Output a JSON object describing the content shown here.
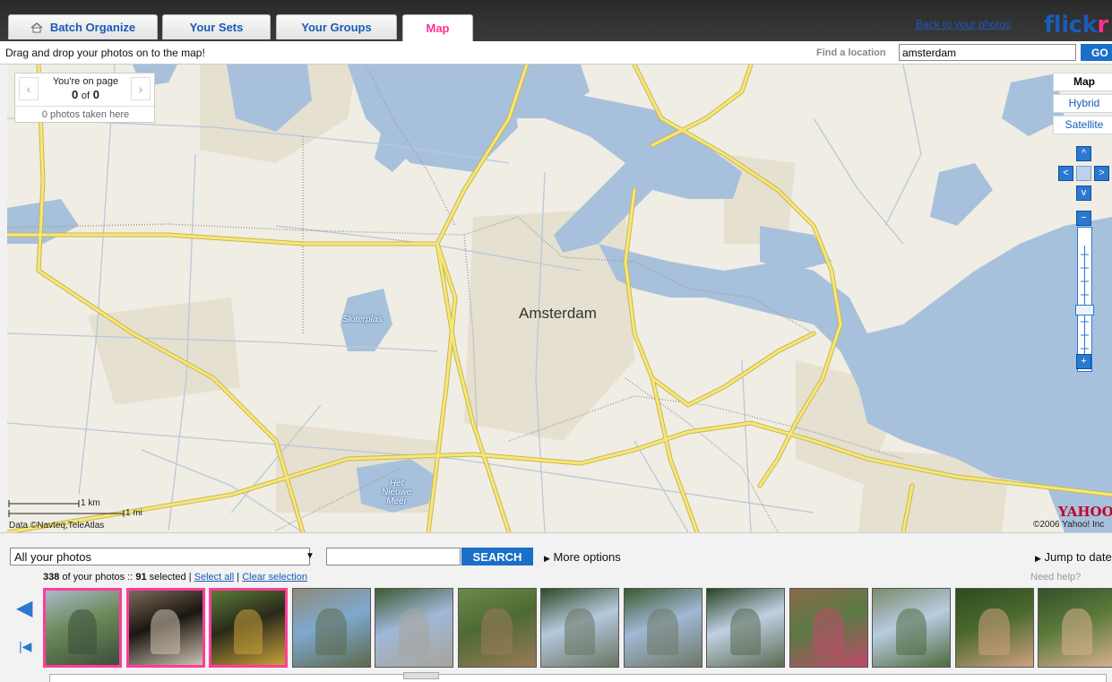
{
  "app": {
    "logo_part1": "flick",
    "logo_part2": "r",
    "back_link": "Back to your photos"
  },
  "tabs": [
    {
      "label": "Batch Organize",
      "icon": "home-icon"
    },
    {
      "label": "Your Sets"
    },
    {
      "label": "Your Groups"
    },
    {
      "label": "Map",
      "active": true
    }
  ],
  "toolbar": {
    "instruction": "Drag and drop your photos on to the map!",
    "find_label": "Find a location",
    "find_value": "amsterdam",
    "go_label": "GO"
  },
  "pager": {
    "line1": "You're on page",
    "page_current": "0",
    "of_text": "of",
    "page_total": "0",
    "photos_here": "0 photos taken here"
  },
  "map_types": [
    {
      "label": "Map",
      "selected": true
    },
    {
      "label": "Hybrid"
    },
    {
      "label": "Satellite"
    }
  ],
  "map": {
    "city_label": "Amsterdam",
    "lake1_label": "Sloterplas",
    "lake2_label_1": "Het",
    "lake2_label_2": "Nieuwe",
    "lake2_label_3": "Meer",
    "scale_km": "1 km",
    "scale_mi": "1 mi",
    "credit": "Data ©Navteq,TeleAtlas",
    "provider_logo": "YAHOO",
    "copyright": "©2006 Yahoo! Inc",
    "colors": {
      "land": "#f0ede4",
      "water": "#a7c1dc",
      "road": "#f7e67a",
      "road_edge": "#c8b84d",
      "minor_road": "#b8c8da",
      "rail": "#9a9a9a",
      "park": "#e6e0d0"
    }
  },
  "controls": {
    "filter_value": "All your photos",
    "search_button": "SEARCH",
    "more_options": "More options",
    "jump_to_date": "Jump to date",
    "need_help": "Need help?"
  },
  "selection": {
    "count": "338",
    "count_suffix": " of your photos :: ",
    "selected": "91",
    "selected_suffix": " selected | ",
    "select_all": "Select all",
    "separator": " | ",
    "clear": "Clear selection"
  },
  "thumbnails": [
    {
      "subject": "canal-photo",
      "selected": true,
      "c1": "#6a8a5a",
      "c2": "#3d4d3a",
      "c3": "#a9b9c8"
    },
    {
      "subject": "statue-photo",
      "selected": true,
      "c1": "#1a1612",
      "c2": "#cfc3b0",
      "c3": "#7a6a58"
    },
    {
      "subject": "night-building-photo",
      "selected": true,
      "c1": "#2a2a1a",
      "c2": "#c9a23a",
      "c3": "#5a7a3a"
    },
    {
      "subject": "valley-photo",
      "selected": false,
      "c1": "#7fa8d0",
      "c2": "#5c6a4a",
      "c3": "#8e8a78"
    },
    {
      "subject": "cliff-photo",
      "selected": false,
      "c1": "#9fb8d8",
      "c2": "#a8a49a",
      "c3": "#3d5a30"
    },
    {
      "subject": "person-bench-photo",
      "selected": false,
      "c1": "#4e6a34",
      "c2": "#9a7a5a",
      "c3": "#6a8a48"
    },
    {
      "subject": "waterfall-photo",
      "selected": false,
      "c1": "#b5c8de",
      "c2": "#6a7460",
      "c3": "#2e4a26"
    },
    {
      "subject": "waterfall-photo-2",
      "selected": false,
      "c1": "#a0b8d6",
      "c2": "#6e7866",
      "c3": "#3a5a2e"
    },
    {
      "subject": "waterfall-photo-3",
      "selected": false,
      "c1": "#c0d0e2",
      "c2": "#5a6a52",
      "c3": "#2a4424"
    },
    {
      "subject": "family-photo",
      "selected": false,
      "c1": "#5a7a44",
      "c2": "#c04a6a",
      "c3": "#8a6a4a"
    },
    {
      "subject": "trees-photo",
      "selected": false,
      "c1": "#b8cce2",
      "c2": "#4e6a3e",
      "c3": "#7a8a6a"
    },
    {
      "subject": "boy-portrait-photo",
      "selected": false,
      "c1": "#4a6a2e",
      "c2": "#d0a080",
      "c3": "#2e4a1e"
    },
    {
      "subject": "boy-portrait-photo-2",
      "selected": false,
      "c1": "#5a7a3a",
      "c2": "#d8b090",
      "c3": "#36502a"
    }
  ]
}
